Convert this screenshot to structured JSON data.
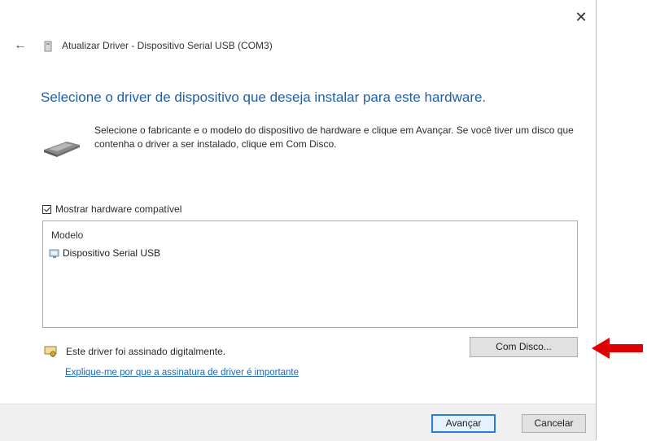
{
  "window": {
    "title": "Atualizar Driver - Dispositivo Serial USB (COM3)",
    "close_glyph": "✕",
    "back_glyph": "←"
  },
  "heading": "Selecione o driver de dispositivo que deseja instalar para este hardware.",
  "instructions": "Selecione o fabricante e o modelo do dispositivo de hardware e clique em Avançar. Se você tiver um disco que contenha o driver a ser instalado, clique em Com Disco.",
  "compatible_checkbox": {
    "label": "Mostrar hardware compatível",
    "checked": true
  },
  "model_list": {
    "column_header": "Modelo",
    "items": [
      {
        "label": "Dispositivo Serial USB",
        "icon": "usb-device-icon"
      }
    ]
  },
  "signature": {
    "text": "Este driver foi assinado digitalmente.",
    "link": "Explique-me por que a assinatura de driver é importante"
  },
  "buttons": {
    "com_disco": "Com Disco...",
    "avancar": "Avançar",
    "cancelar": "Cancelar"
  },
  "colors": {
    "heading": "#1f5fa6",
    "link": "#1b67b8",
    "primary_button_border": "#2b7bd8",
    "annotation_arrow": "#e00000"
  }
}
